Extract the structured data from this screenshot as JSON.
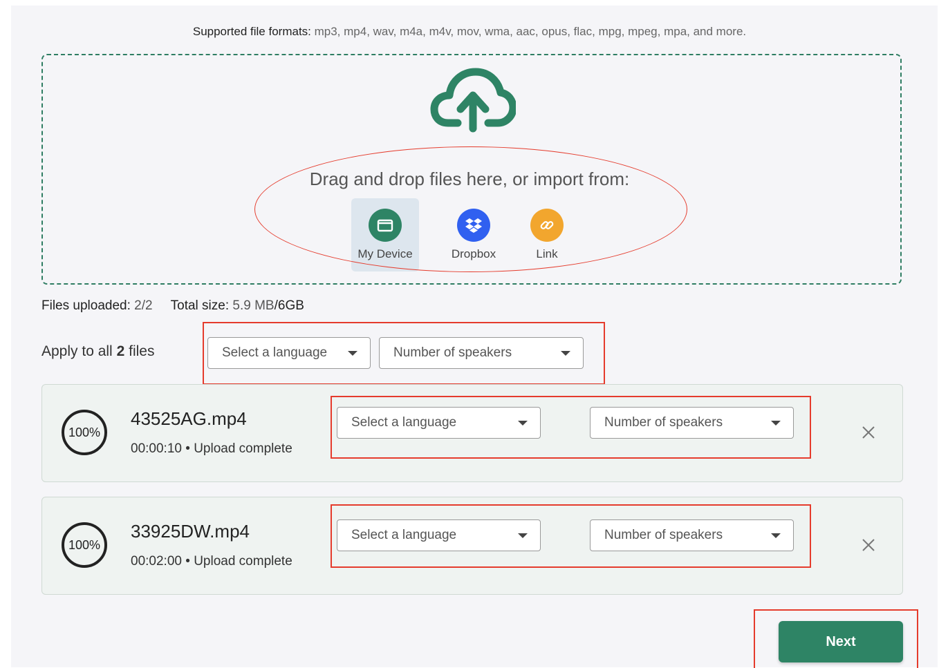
{
  "formats": {
    "label": "Supported file formats:",
    "list": " mp3, mp4, wav, m4a, m4v, mov, wma, aac, opus, flac, mpg, mpeg, mpa, and more."
  },
  "dropzone": {
    "upload_icon": "cloud-upload-icon",
    "text": "Drag and drop files here, or import from:",
    "sources": [
      {
        "label": "My Device",
        "icon": "folder-icon",
        "color": "#2e8465"
      },
      {
        "label": "Dropbox",
        "icon": "dropbox-icon",
        "color": "#3060f0"
      },
      {
        "label": "Link",
        "icon": "link-icon",
        "color": "#f2a62e"
      }
    ]
  },
  "stats": {
    "files_label": "Files uploaded:",
    "files_value": "2/2",
    "size_label": "Total size:",
    "size_value": "5.9 MB",
    "size_limit": "/6GB"
  },
  "apply_all": {
    "prefix": "Apply to all",
    "count": "2",
    "suffix": "files",
    "language_placeholder": "Select a language",
    "speakers_placeholder": "Number of speakers"
  },
  "files": [
    {
      "progress": "100%",
      "name": "43525AG.mp4",
      "duration": "00:00:10",
      "status": "Upload complete",
      "language": "Select a language",
      "speakers": "Number of speakers"
    },
    {
      "progress": "100%",
      "name": "33925DW.mp4",
      "duration": "00:02:00",
      "status": "Upload complete",
      "language": "Select a language",
      "speakers": "Number of speakers"
    }
  ],
  "next_label": "Next",
  "colors": {
    "accent": "#2e8465",
    "highlight": "#e53b2c"
  }
}
